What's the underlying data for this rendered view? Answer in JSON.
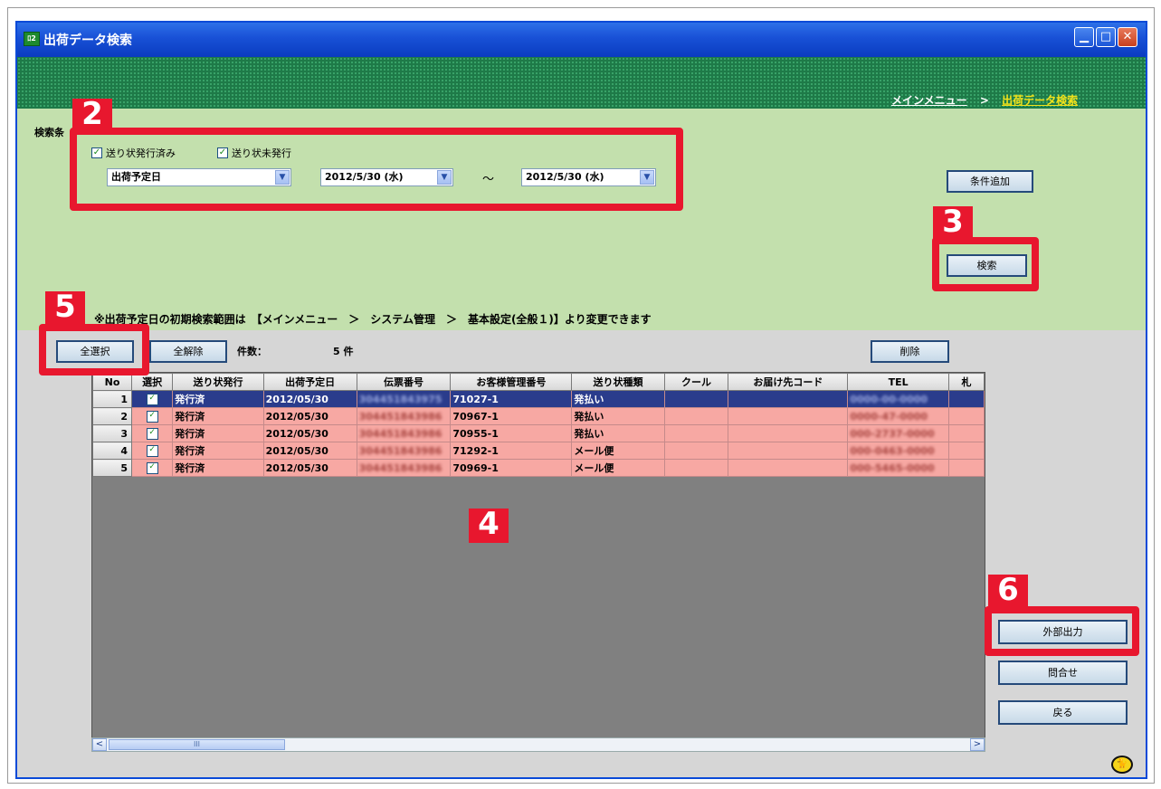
{
  "window": {
    "title": "出荷データ検索",
    "icon_name": "app-icon",
    "icon_text": "ﾛ2",
    "controls": [
      "minimize-icon",
      "maximize-icon",
      "close-icon"
    ],
    "control_glyphs": {
      "minimize": "▁",
      "maximize": "□",
      "close": "✕"
    }
  },
  "breadcrumb": {
    "main_menu": "メインメニュー",
    "separator": ">",
    "current": "出荷データ検索"
  },
  "search": {
    "section_label": "検索条",
    "checkbox_issued_label": "送り状発行済み",
    "checkbox_unissued_label": "送り状未発行",
    "checkbox_issued_checked": true,
    "checkbox_unissued_checked": true,
    "field_select": "出荷予定日",
    "date_from": "2012/5/30 (水)",
    "tilde": "～",
    "date_to": "2012/5/30 (水)",
    "add_condition_button": "条件追加",
    "search_button": "検索"
  },
  "note": "※出荷予定日の初期検索範囲は　【メインメニュー　＞　システム管理　＞　基本設定(全般１)】より変更できます",
  "toolbar": {
    "select_all_button": "全選択",
    "deselect_all_button": "全解除",
    "count_label": "件数：",
    "count_value": "5 件",
    "delete_button": "削除"
  },
  "grid": {
    "columns": [
      "No",
      "選択",
      "送り状発行",
      "出荷予定日",
      "伝票番号",
      "お客様管理番号",
      "送り状種類",
      "クール",
      "お届け先コード",
      "TEL",
      "札"
    ],
    "rows": [
      {
        "no": "1",
        "checked": true,
        "issued": "発行済",
        "date": "2012/05/30",
        "slip": "304451843975",
        "customer_no": "71027-1",
        "type": "発払い",
        "cool": "",
        "dest_code": "",
        "tel": "0000-00-0000",
        "selected": true
      },
      {
        "no": "2",
        "checked": true,
        "issued": "発行済",
        "date": "2012/05/30",
        "slip": "304451843986",
        "customer_no": "70967-1",
        "type": "発払い",
        "cool": "",
        "dest_code": "",
        "tel": "0000-47-0000",
        "selected": false
      },
      {
        "no": "3",
        "checked": true,
        "issued": "発行済",
        "date": "2012/05/30",
        "slip": "304451843986",
        "customer_no": "70955-1",
        "type": "発払い",
        "cool": "",
        "dest_code": "",
        "tel": "000-2737-0000",
        "selected": false
      },
      {
        "no": "4",
        "checked": true,
        "issued": "発行済",
        "date": "2012/05/30",
        "slip": "304451843986",
        "customer_no": "71292-1",
        "type": "メール便",
        "cool": "",
        "dest_code": "",
        "tel": "000-0463-0000",
        "selected": false
      },
      {
        "no": "5",
        "checked": true,
        "issued": "発行済",
        "date": "2012/05/30",
        "slip": "304451843986",
        "customer_no": "70969-1",
        "type": "メール便",
        "cool": "",
        "dest_code": "",
        "tel": "000-5465-0000",
        "selected": false
      }
    ],
    "check_glyph": "✓"
  },
  "side_buttons": {
    "export": "外部出力",
    "inquiry": "問合せ",
    "back": "戻る"
  },
  "scrollbar": {
    "left_arrow": "<",
    "right_arrow": ">",
    "thumb_grip": "III"
  },
  "annotations": {
    "label_2": "2",
    "label_3": "3",
    "label_4": "4",
    "label_5": "5",
    "label_6": "6"
  },
  "colors": {
    "titlebar": "#1850d6",
    "header_pattern": "#1e7a48",
    "search_area": "#c3e0ad",
    "row_highlight": "#f7a8a3",
    "row_selected": "#2a3c8c",
    "annotation_red": "#e8172e",
    "breadcrumb_current": "#f3e21a"
  },
  "logo": {
    "icon_name": "black-cat-logo-icon",
    "glyph": "🐈"
  }
}
